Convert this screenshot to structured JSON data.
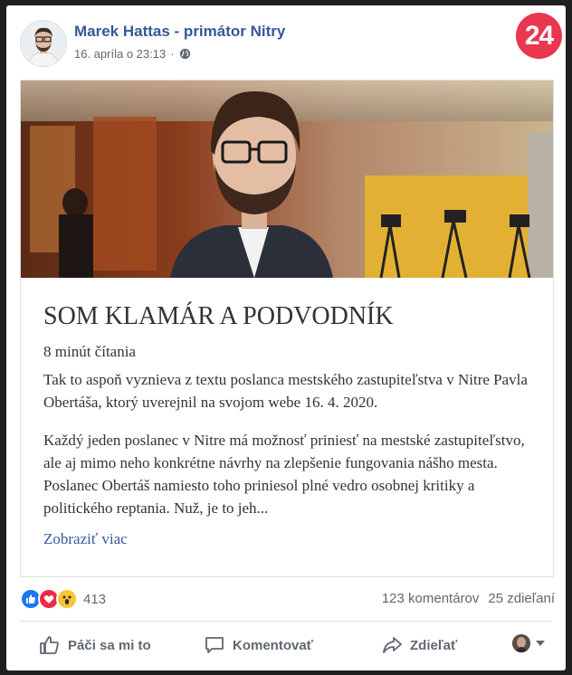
{
  "post": {
    "author": "Marek Hattas - primátor Nitry",
    "timestamp": "16. apríla o 23:13",
    "separator": "·",
    "privacy_icon": "globe-icon",
    "badge": "24"
  },
  "article": {
    "headline": "SOM KLAMÁR A PODVODNÍK",
    "read_time": "8 minút čítania",
    "paragraph1": "Tak to aspoň vyznieva z textu poslanca mestského zastupiteľstva v Nitre Pavla Obertáša, ktorý uverejnil na svojom webe 16. 4. 2020.",
    "paragraph2": "Každý jeden poslanec v Nitre má možnosť priniesť na mestské zastupiteľstvo, ale aj mimo neho konkrétne návrhy na zlepšenie fungovania nášho mesta. Poslanec Obertáš namiesto toho priniesol plné vedro osobnej kritiky a politického reptania. Nuž, je to jeh...",
    "show_more": "Zobraziť viac"
  },
  "stats": {
    "reactions": [
      "like",
      "love",
      "wow"
    ],
    "reaction_count": "413",
    "comments": "123 komentárov",
    "shares": "25 zdieľaní"
  },
  "actions": {
    "like": "Páči sa mi to",
    "comment": "Komentovať",
    "share": "Zdieľať"
  },
  "colors": {
    "link": "#365899",
    "badge": "#e8374e",
    "like": "#1877f2"
  }
}
